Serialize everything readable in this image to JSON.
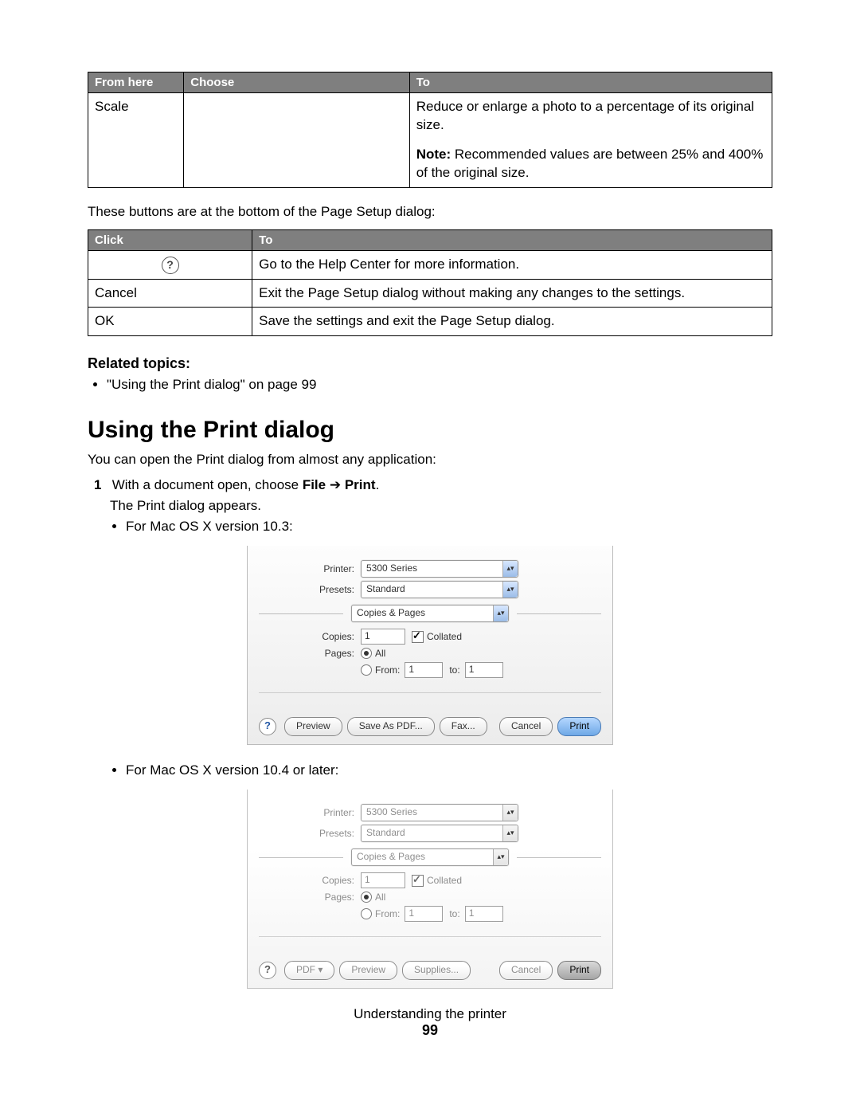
{
  "table1": {
    "headers": [
      "From here",
      "Choose",
      "To"
    ],
    "row": {
      "from": "Scale",
      "choose": "",
      "to_line1": "Reduce or enlarge a photo to a percentage of its original size.",
      "note_label": "Note:",
      "note_text": " Recommended values are between 25% and 400% of the original size."
    }
  },
  "para1": "These buttons are at the bottom of the Page Setup dialog:",
  "table2": {
    "headers": [
      "Click",
      "To"
    ],
    "rows": [
      {
        "click": "help-icon",
        "to": "Go to the Help Center for more information."
      },
      {
        "click": "Cancel",
        "to": "Exit the Page Setup dialog without making any changes to the settings."
      },
      {
        "click": "OK",
        "to": "Save the settings and exit the Page Setup dialog."
      }
    ]
  },
  "related_heading": "Related topics:",
  "related_item": "\"Using the Print dialog\" on page 99",
  "section_heading": "Using the Print dialog",
  "para2": "You can open the Print dialog from almost any application:",
  "step1_num": "1",
  "step1_pre": "With a document open, choose ",
  "step1_bold1": "File",
  "step1_arrow": " ➔ ",
  "step1_bold2": "Print",
  "step1_post": ".",
  "step1_sub": "The Print dialog appears.",
  "bullet_103": "For Mac OS X version 10.3:",
  "bullet_104": "For Mac OS X version 10.4 or later:",
  "dlg_103": {
    "printer_label": "Printer:",
    "printer_value": "5300 Series",
    "presets_label": "Presets:",
    "presets_value": "Standard",
    "pane_value": "Copies & Pages",
    "copies_label": "Copies:",
    "copies_value": "1",
    "collated": "Collated",
    "pages_label": "Pages:",
    "all": "All",
    "from_label": "From:",
    "from_value": "1",
    "to_label": "to:",
    "to_value": "1",
    "help": "?",
    "preview": "Preview",
    "save_pdf": "Save As PDF...",
    "fax": "Fax...",
    "cancel": "Cancel",
    "print": "Print"
  },
  "dlg_104": {
    "printer_label": "Printer:",
    "printer_value": "5300 Series",
    "presets_label": "Presets:",
    "presets_value": "Standard",
    "pane_value": "Copies & Pages",
    "copies_label": "Copies:",
    "copies_value": "1",
    "collated": "Collated",
    "pages_label": "Pages:",
    "all": "All",
    "from_label": "From:",
    "from_value": "1",
    "to_label": "to:",
    "to_value": "1",
    "help": "?",
    "pdf": "PDF ▾",
    "preview": "Preview",
    "supplies": "Supplies...",
    "cancel": "Cancel",
    "print": "Print"
  },
  "footer_title": "Understanding the printer",
  "footer_page": "99",
  "qmark_glyph": "?"
}
